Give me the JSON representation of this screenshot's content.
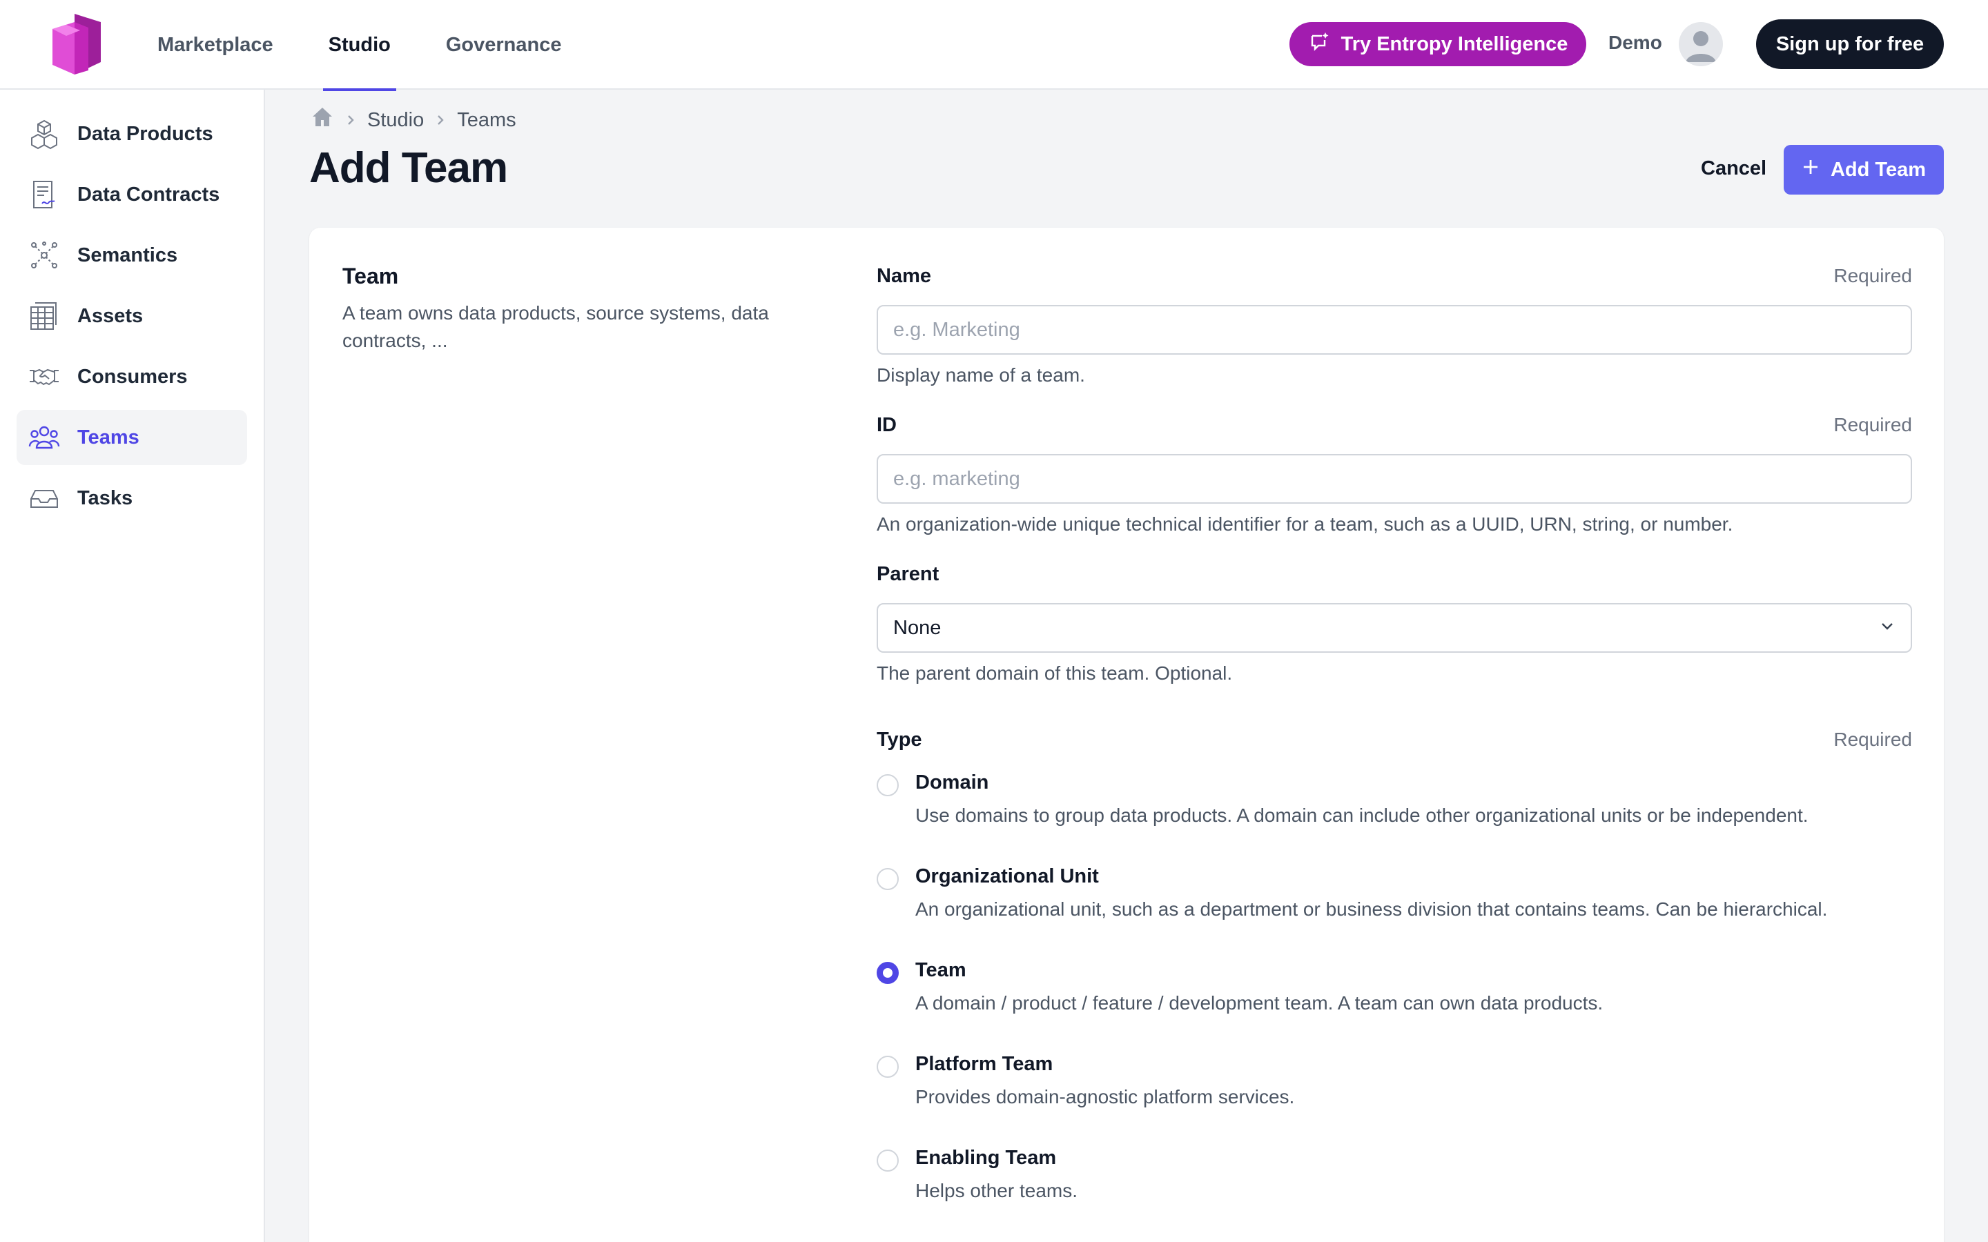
{
  "header": {
    "nav": [
      {
        "label": "Marketplace",
        "active": false
      },
      {
        "label": "Studio",
        "active": true
      },
      {
        "label": "Governance",
        "active": false
      }
    ],
    "try_button": "Try Entropy Intelligence",
    "user_label": "Demo",
    "signup_button": "Sign up for free",
    "colors": {
      "accent": "#4f46e5",
      "try_button": "#a21caf",
      "signup_button": "#111827"
    }
  },
  "sidebar": {
    "items": [
      {
        "label": "Data Products",
        "icon": "cubes-icon",
        "active": false
      },
      {
        "label": "Data Contracts",
        "icon": "contract-icon",
        "active": false
      },
      {
        "label": "Semantics",
        "icon": "graph-icon",
        "active": false
      },
      {
        "label": "Assets",
        "icon": "table-icon",
        "active": false
      },
      {
        "label": "Consumers",
        "icon": "handshake-icon",
        "active": false
      },
      {
        "label": "Teams",
        "icon": "users-icon",
        "active": true
      },
      {
        "label": "Tasks",
        "icon": "inbox-icon",
        "active": false
      }
    ]
  },
  "breadcrumb": {
    "items": [
      "Studio",
      "Teams"
    ]
  },
  "page": {
    "title": "Add Team",
    "cancel_button": "Cancel",
    "add_button": "Add Team"
  },
  "form": {
    "section_title": "Team",
    "section_description": "A team owns data products, source systems, data contracts, ...",
    "name": {
      "label": "Name",
      "required": "Required",
      "placeholder": "e.g. Marketing",
      "value": "",
      "help": "Display name of a team."
    },
    "id": {
      "label": "ID",
      "required": "Required",
      "placeholder": "e.g. marketing",
      "value": "",
      "help": "An organization-wide unique technical identifier for a team, such as a UUID, URN, string, or number."
    },
    "parent": {
      "label": "Parent",
      "selected": "None",
      "help": "The parent domain of this team. Optional."
    },
    "type": {
      "label": "Type",
      "required": "Required",
      "options": [
        {
          "label": "Domain",
          "description": "Use domains to group data products. A domain can include other organizational units or be independent.",
          "checked": false
        },
        {
          "label": "Organizational Unit",
          "description": "An organizational unit, such as a department or business division that contains teams. Can be hierarchical.",
          "checked": false
        },
        {
          "label": "Team",
          "description": "A domain / product / feature / development team. A team can own data products.",
          "checked": true
        },
        {
          "label": "Platform Team",
          "description": "Provides domain-agnostic platform services.",
          "checked": false
        },
        {
          "label": "Enabling Team",
          "description": "Helps other teams.",
          "checked": false
        }
      ]
    }
  }
}
